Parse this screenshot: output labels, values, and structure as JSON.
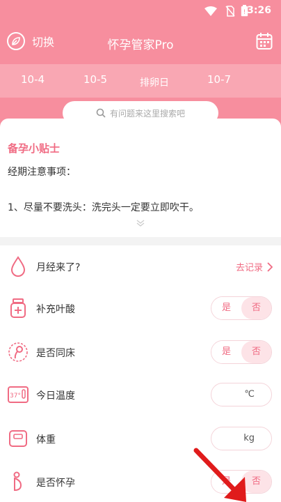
{
  "status": {
    "time": "3:26"
  },
  "header": {
    "switch_label": "切换",
    "title": "怀孕管家Pro"
  },
  "dates": [
    "10-4",
    "10-5",
    "排卵日",
    "10-7"
  ],
  "search": {
    "placeholder": "有问题来这里搜索吧"
  },
  "tips": {
    "title": "备孕小贴士",
    "subtitle": "经期注意事项：",
    "body": "1、尽量不要洗头：洗完头一定要立即吹干。"
  },
  "rows": [
    {
      "label": "月经来了?",
      "action": "去记录"
    },
    {
      "label": "补充叶酸",
      "yes": "是",
      "no": "否"
    },
    {
      "label": "是否同床",
      "yes": "是",
      "no": "否"
    },
    {
      "label": "今日温度",
      "unit": "℃"
    },
    {
      "label": "体重",
      "unit": "kg"
    },
    {
      "label": "是否怀孕",
      "yes": "是",
      "no": "否"
    }
  ],
  "colors": {
    "primary": "#f78e9e",
    "strip": "#f9a7b3",
    "accent": "#f06b83",
    "arrow": "#e01b1b"
  }
}
